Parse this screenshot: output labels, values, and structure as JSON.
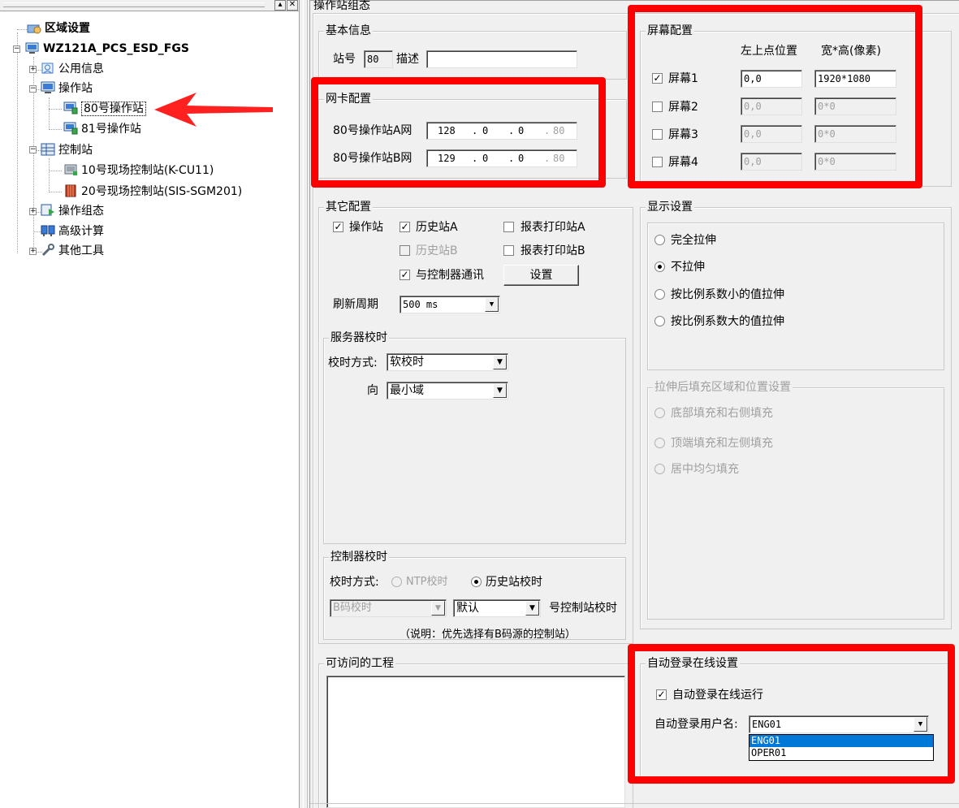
{
  "tree": {
    "root": "区域设置",
    "project": "WZ121A_PCS_ESD_FGS",
    "public_info": "公用信息",
    "operator_stations": "操作站",
    "op80": "80号操作站",
    "op81": "81号操作站",
    "control_stations": "控制站",
    "cs10": "10号现场控制站(K-CU11)",
    "cs20": "20号现场控制站(SIS-SGM201)",
    "op_config": "操作组态",
    "adv_calc": "高级计算",
    "other_tools": "其他工具"
  },
  "panel": {
    "title": "操作站组态",
    "basic": {
      "title": "基本信息",
      "station_no_label": "站号",
      "station_no": "80",
      "desc_label": "描述",
      "desc_value": ""
    },
    "nic": {
      "title": "网卡配置",
      "net_a_label": "80号操作站A网",
      "net_b_label": "80号操作站B网",
      "net_a": [
        "128",
        "0",
        "0",
        "80"
      ],
      "net_b": [
        "129",
        "0",
        "0",
        "80"
      ],
      "dot": "."
    },
    "screen": {
      "title": "屏幕配置",
      "col_pos": "左上点位置",
      "col_size": "宽*高(像素)",
      "rows": [
        {
          "label": "屏幕1",
          "checked": "☑",
          "pos": "0,0",
          "size": "1920*1080"
        },
        {
          "label": "屏幕2",
          "checked": "",
          "pos": "0,0",
          "size": "0*0"
        },
        {
          "label": "屏幕3",
          "checked": "",
          "pos": "0,0",
          "size": "0*0"
        },
        {
          "label": "屏幕4",
          "checked": "",
          "pos": "0,0",
          "size": "0*0"
        }
      ]
    },
    "other": {
      "title": "其它配置",
      "op_station": "操作站",
      "history_a": "历史站A",
      "report_a": "报表打印站A",
      "history_b": "历史站B",
      "report_b": "报表打印站B",
      "ctrl_comm": "与控制器通讯",
      "setup_btn": "设置",
      "refresh_label": "刷新周期",
      "refresh_value": "500 ms",
      "check_mark": "✓"
    },
    "server_time": {
      "title": "服务器校时",
      "mode_label": "校时方式:",
      "mode_value": "软校时",
      "dir_label": "向",
      "dir_value": "最小域"
    },
    "ctrl_time": {
      "title": "控制器校时",
      "mode_label": "校时方式:",
      "ntp": "NTP校时",
      "history": "历史站校时",
      "bcode": "B码校时",
      "default": "默认",
      "suffix": "号控制站校时",
      "note": "（说明：优先选择有B码源的控制站）"
    },
    "display": {
      "title": "显示设置",
      "opt1": "完全拉伸",
      "opt2": "不拉伸",
      "opt3": "按比例系数小的值拉伸",
      "opt4": "按比例系数大的值拉伸",
      "fill_title": "拉伸后填充区域和位置设置",
      "fill1": "底部填充和右侧填充",
      "fill2": "顶端填充和左侧填充",
      "fill3": "居中均匀填充"
    },
    "projects": {
      "title": "可访问的工程"
    },
    "autologin": {
      "title": "自动登录在线设置",
      "enable": "自动登录在线运行",
      "user_label": "自动登录用户名:",
      "user_value": "ENG01",
      "options": [
        "ENG01",
        "OPER01"
      ]
    }
  }
}
